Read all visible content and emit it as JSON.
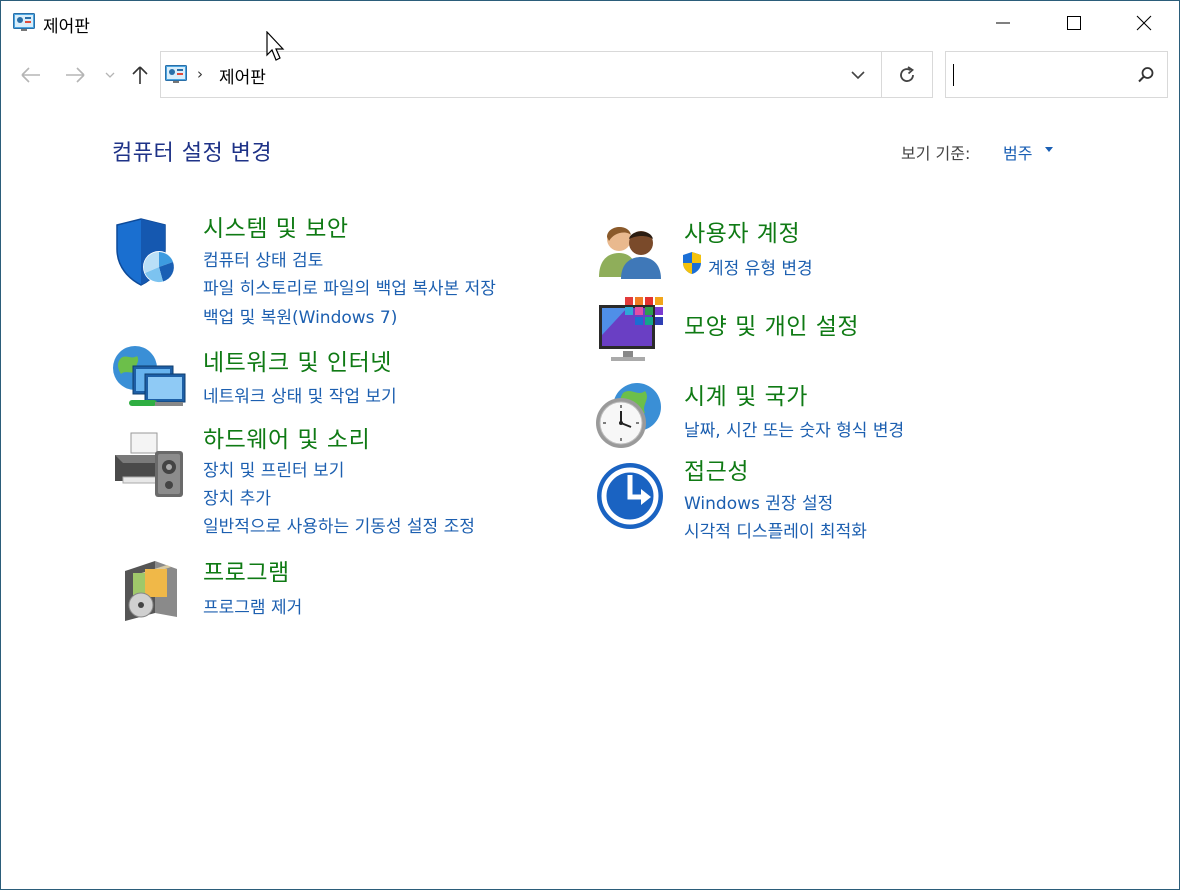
{
  "window": {
    "title": "제어판"
  },
  "address": {
    "separator": "›",
    "path": "제어판"
  },
  "search": {
    "placeholder": ""
  },
  "header": {
    "title": "컴퓨터 설정 변경",
    "view_by_label": "보기 기준:",
    "view_by_value": "범주"
  },
  "categories": {
    "system": {
      "title": "시스템 및 보안",
      "links": [
        "컴퓨터 상태 검토",
        "파일 히스토리로 파일의 백업 복사본 저장",
        "백업 및 복원(Windows 7)"
      ]
    },
    "network": {
      "title": "네트워크 및 인터넷",
      "links": [
        "네트워크 상태 및 작업 보기"
      ]
    },
    "hardware": {
      "title": "하드웨어 및 소리",
      "links": [
        "장치 및 프린터 보기",
        "장치 추가",
        "일반적으로 사용하는 기동성 설정 조정"
      ]
    },
    "programs": {
      "title": "프로그램",
      "links": [
        "프로그램 제거"
      ]
    },
    "users": {
      "title": "사용자 계정",
      "links": [
        "계정 유형 변경"
      ]
    },
    "appearance": {
      "title": "모양 및 개인 설정",
      "links": []
    },
    "clock": {
      "title": "시계 및 국가",
      "links": [
        "날짜, 시간 또는 숫자 형식 변경"
      ]
    },
    "ease": {
      "title": "접근성",
      "links": [
        "Windows 권장 설정",
        "시각적 디스플레이 최적화"
      ]
    }
  },
  "icons": {
    "title": "control-panel-icon",
    "minimize": "minimize-icon",
    "maximize": "maximize-icon",
    "close": "close-icon",
    "back": "back-arrow-icon",
    "forward": "forward-arrow-icon",
    "recent": "chevron-down-icon",
    "up": "up-arrow-icon",
    "refresh": "refresh-icon",
    "search": "search-icon"
  },
  "colors": {
    "category_title": "#0f7a14",
    "link": "#1c5fb0",
    "page_title": "#1e3287",
    "border": "#d9d9d9"
  }
}
